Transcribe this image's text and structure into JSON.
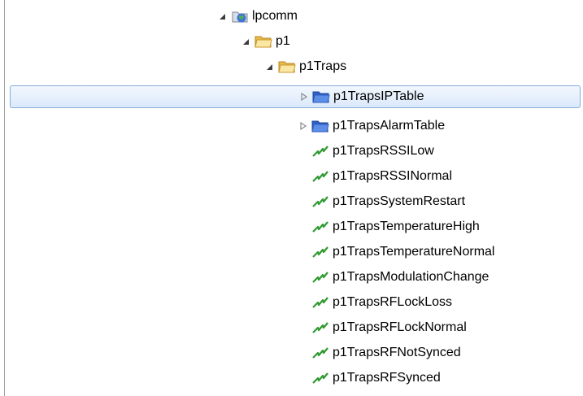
{
  "tree": {
    "items": [
      {
        "label": "lpcomm",
        "icon": "module-globe-icon",
        "expander": "expanded"
      },
      {
        "label": "p1",
        "icon": "folder-icon",
        "expander": "expanded"
      },
      {
        "label": "p1Traps",
        "icon": "folder-icon",
        "expander": "expanded"
      },
      {
        "label": "p1TrapsIPTable",
        "icon": "table-folder-icon",
        "expander": "collapsed",
        "selected": true
      },
      {
        "label": "p1TrapsAlarmTable",
        "icon": "table-folder-icon",
        "expander": "collapsed"
      },
      {
        "label": "p1TrapsRSSILow",
        "icon": "trap-icon"
      },
      {
        "label": "p1TrapsRSSINormal",
        "icon": "trap-icon"
      },
      {
        "label": "p1TrapsSystemRestart",
        "icon": "trap-icon"
      },
      {
        "label": "p1TrapsTemperatureHigh",
        "icon": "trap-icon"
      },
      {
        "label": "p1TrapsTemperatureNormal",
        "icon": "trap-icon"
      },
      {
        "label": "p1TrapsModulationChange",
        "icon": "trap-icon"
      },
      {
        "label": "p1TrapsRFLockLoss",
        "icon": "trap-icon"
      },
      {
        "label": "p1TrapsRFLockNormal",
        "icon": "trap-icon"
      },
      {
        "label": "p1TrapsRFNotSynced",
        "icon": "trap-icon"
      },
      {
        "label": "p1TrapsRFSynced",
        "icon": "trap-icon"
      }
    ]
  },
  "colors": {
    "selection_border": "#84acdd",
    "selection_fill": "#dbe9fb",
    "folder_yellow": "#f7d57b",
    "folder_blue": "#3f73d6",
    "trap_green": "#2f9a2f",
    "border": "#a0a0a0"
  }
}
